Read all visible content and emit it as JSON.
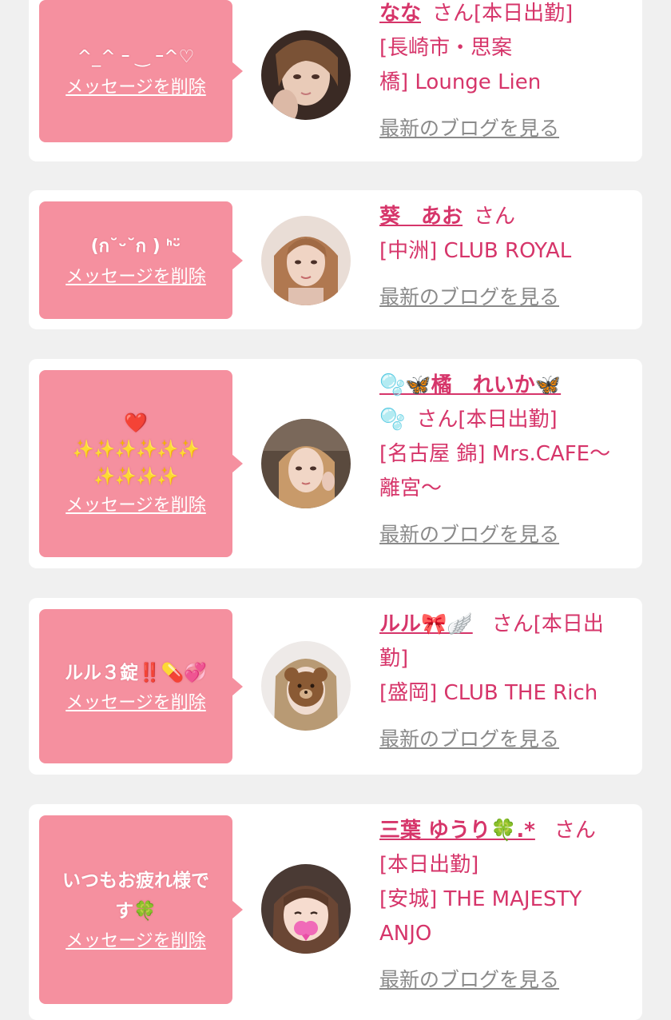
{
  "delete_label": "メッセージを削除",
  "blog_label": "最新のブログを見る",
  "san_label": "さん",
  "colors": {
    "pink": "#f5909f",
    "name": "#d6356a",
    "background": "#f0f0f0"
  },
  "cards": [
    {
      "message": "^_^ ｰ ‿ ｰ^♡",
      "name": "なな",
      "san_suffix": "[本日出勤]",
      "shop_line1": "[長崎市・思案",
      "shop_line2": "橋] Lounge Lien"
    },
    {
      "message": "(ก˘ᵕ˘ก ) ᑋᵕ̈",
      "name": "葵　あお",
      "san_suffix": "",
      "shop_line1": "[中洲] CLUB ROYAL",
      "shop_line2": ""
    },
    {
      "message_line1": "❤️",
      "message_line2": "✨✨✨✨✨✨",
      "message_line3": "✨✨✨✨",
      "name": "🫧🦋橘　れいか🦋",
      "name_line2": "🫧",
      "san_suffix": "[本日出勤]",
      "shop_line1": "[名古屋 錦] Mrs.CAFE〜",
      "shop_line2": "離宮〜"
    },
    {
      "message": "ルル３錠‼️💊💞",
      "name": "ルル🎀🪽",
      "san_suffix": "[本日出",
      "san_suffix2": "勤]",
      "shop_line1": "[盛岡] CLUB THE Rich",
      "shop_line2": ""
    },
    {
      "message_line1": "いつもお疲れ様で",
      "message_line2": "す🍀",
      "name": "三葉 ゆうり🍀.*",
      "san_suffix2": "[本日出勤]",
      "shop_line1": "[安城] THE MAJESTY",
      "shop_line2": "ANJO"
    }
  ]
}
